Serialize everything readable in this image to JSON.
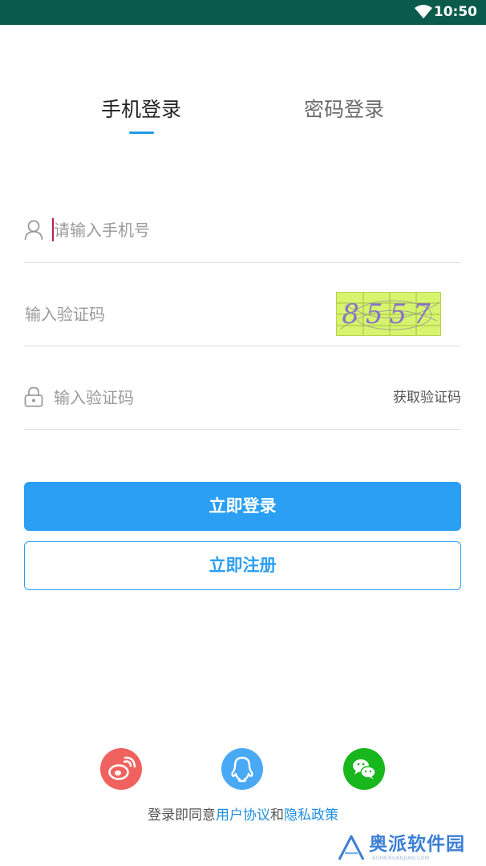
{
  "status_bar": {
    "time": "10:50",
    "wifi_icon": "wifi-icon"
  },
  "tabs": [
    {
      "label": "手机登录",
      "active": true
    },
    {
      "label": "密码登录",
      "active": false
    }
  ],
  "form": {
    "phone": {
      "placeholder": "请输入手机号",
      "icon": "user-icon"
    },
    "captcha": {
      "placeholder": "输入验证码",
      "image_code": "8557"
    },
    "sms_code": {
      "placeholder": "输入验证码",
      "icon": "lock-icon",
      "get_code_label": "获取验证码"
    }
  },
  "buttons": {
    "login": "立即登录",
    "register": "立即注册"
  },
  "social": [
    {
      "icon": "weibo-icon",
      "color": "#f0625f"
    },
    {
      "icon": "qq-icon",
      "color": "#4aa9f5"
    },
    {
      "icon": "wechat-icon",
      "color": "#18b71d"
    }
  ],
  "agreement": {
    "prefix": "登录即同意",
    "user_agreement": "用户协议",
    "and": "和",
    "privacy_policy": "隐私政策"
  },
  "watermark": {
    "text": "奥派软件园",
    "sub": "AOPAIRUANJIAN.COM"
  },
  "colors": {
    "accent": "#2a9ff3",
    "status_bar": "#0b5b4c",
    "captcha_bg": "#d6f46e"
  }
}
